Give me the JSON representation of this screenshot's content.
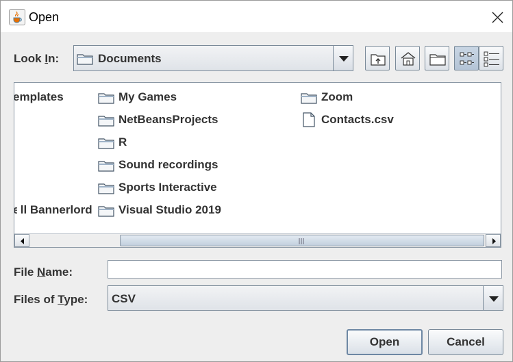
{
  "window": {
    "title": "Open"
  },
  "look_in": {
    "label_pre": "Look ",
    "label_mnemonic": "I",
    "label_post": "n:",
    "selected": "Documents"
  },
  "toolbar": {
    "up_icon": "up-one-level-icon",
    "home_icon": "home-icon",
    "new_folder_icon": "new-folder-icon",
    "list_view_icon": "list-view-icon",
    "details_view_icon": "details-view-icon",
    "list_view_selected": true
  },
  "files": {
    "column1": [
      "emplates",
      "",
      "",
      "",
      "",
      "ll Bannerlord"
    ],
    "column2": [
      "My Games",
      "NetBeansProjects",
      "R",
      "Sound recordings",
      "Sports Interactive",
      "Visual Studio 2019"
    ],
    "column3": [
      {
        "name": "Zoom",
        "type": "folder"
      },
      {
        "name": "Contacts.csv",
        "type": "file"
      }
    ]
  },
  "file_name": {
    "label_pre": "File ",
    "label_mnemonic": "N",
    "label_post": "ame:",
    "value": ""
  },
  "files_of_type": {
    "label_pre": "Files of ",
    "label_mnemonic": "T",
    "label_post": "ype:",
    "selected": "CSV"
  },
  "buttons": {
    "open": "Open",
    "cancel": "Cancel"
  }
}
